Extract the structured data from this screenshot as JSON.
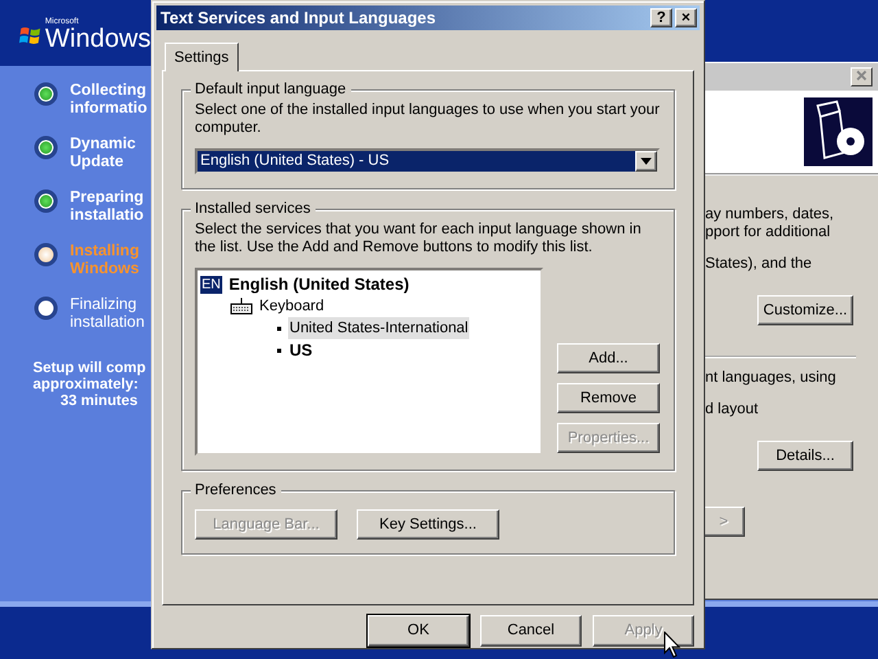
{
  "setup_sidebar": {
    "logo": {
      "small": "Microsoft",
      "name": "Windows"
    },
    "steps": [
      {
        "lines": [
          "Collecting",
          "informatio"
        ],
        "completed": true,
        "current": false
      },
      {
        "lines": [
          "Dynamic",
          "Update"
        ],
        "completed": true,
        "current": false
      },
      {
        "lines": [
          "Preparing",
          "installatio"
        ],
        "completed": true,
        "current": false
      },
      {
        "lines": [
          "Installing",
          "Windows"
        ],
        "completed": false,
        "current": true
      },
      {
        "lines": [
          "Finalizing",
          "installation"
        ],
        "completed": false,
        "current": false
      }
    ],
    "estimate": [
      "Setup will comp",
      "approximately:",
      "33 minutes"
    ]
  },
  "background_window": {
    "items": [
      {
        "kind": "text",
        "lines": [
          "ay numbers, dates,",
          "pport for additional"
        ]
      },
      {
        "kind": "text",
        "lines": [
          "States), and the"
        ]
      },
      {
        "kind": "button",
        "label": "Customize..."
      },
      {
        "kind": "separator"
      },
      {
        "kind": "text",
        "lines": [
          "nt languages, using"
        ]
      },
      {
        "kind": "text",
        "lines": [
          "d layout"
        ]
      },
      {
        "kind": "button",
        "label": "Details..."
      },
      {
        "kind": "partial_button",
        "label": ">"
      }
    ]
  },
  "dialog": {
    "title": "Text Services and Input Languages",
    "title_buttons": [
      "?",
      "×"
    ],
    "tabs": [
      {
        "label": "Settings",
        "selected": true
      }
    ],
    "default_language": {
      "heading": "Default input language",
      "description": "Select one of the installed input languages to use when you start your computer.",
      "value": "English (United States) - US"
    },
    "installed_services": {
      "heading": "Installed services",
      "description": "Select the services that you want for each input language shown in the list. Use the Add and Remove buttons to modify this list.",
      "tree": [
        {
          "badge": "EN",
          "label": "English (United States)",
          "children": [
            {
              "label": "Keyboard",
              "children": [
                {
                  "label": "United States-International",
                  "selected": true,
                  "default": false
                },
                {
                  "label": "US",
                  "selected": false,
                  "default": true
                }
              ]
            }
          ]
        }
      ],
      "buttons": [
        {
          "label": "Add...",
          "disabled": false
        },
        {
          "label": "Remove",
          "disabled": false
        },
        {
          "label": "Properties...",
          "disabled": true
        }
      ]
    },
    "preferences": {
      "heading": "Preferences",
      "buttons": [
        {
          "label": "Language Bar...",
          "disabled": true
        },
        {
          "label": "Key Settings...",
          "disabled": false
        }
      ]
    },
    "footer_buttons": [
      {
        "label": "OK",
        "disabled": false,
        "default": true
      },
      {
        "label": "Cancel",
        "disabled": false,
        "default": false
      },
      {
        "label": "Apply",
        "disabled": true,
        "default": false
      }
    ]
  }
}
